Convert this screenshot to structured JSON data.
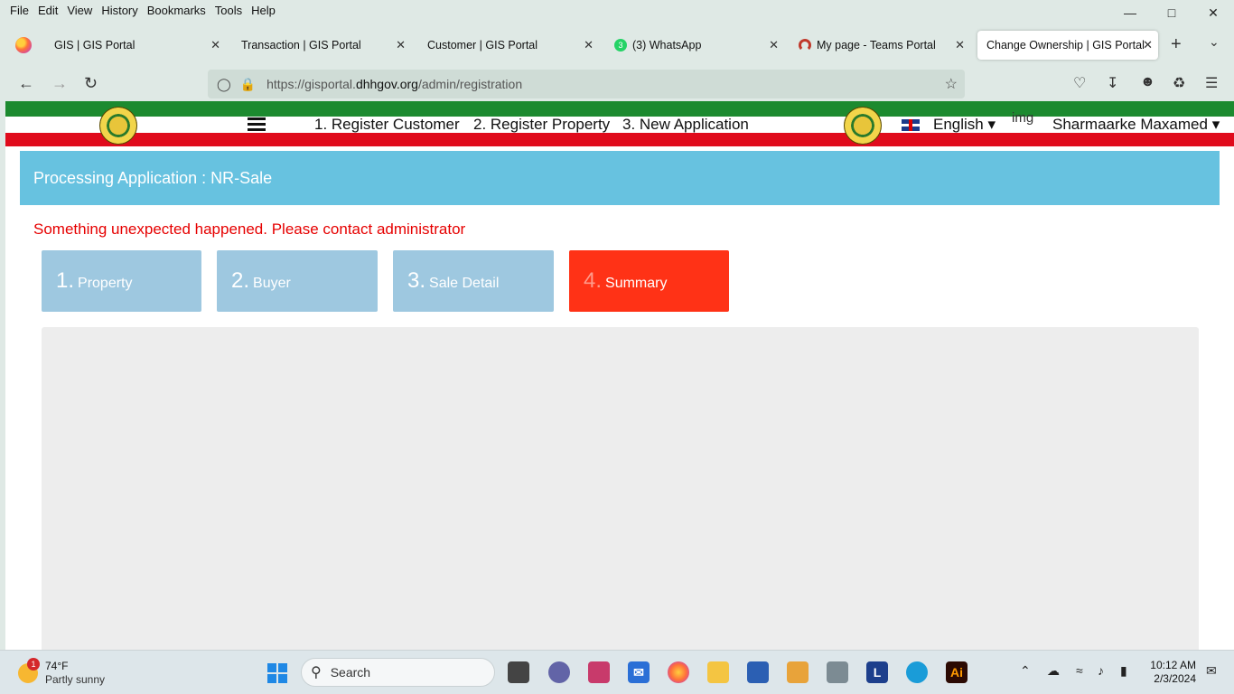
{
  "menubar": {
    "items": [
      "File",
      "Edit",
      "View",
      "History",
      "Bookmarks",
      "Tools",
      "Help"
    ]
  },
  "tabs": [
    {
      "label": "GIS | GIS Portal"
    },
    {
      "label": "Transaction | GIS Portal"
    },
    {
      "label": "Customer | GIS Portal"
    },
    {
      "label": "(3) WhatsApp",
      "badge": "3"
    },
    {
      "label": "My page - Teams Portal"
    },
    {
      "label": "Change Ownership | GIS Portal"
    }
  ],
  "address": {
    "scheme_prefix": "https://gisportal.",
    "host": "dhhgov.org",
    "path": "/admin/registration"
  },
  "site_nav": {
    "links": [
      "1. Register Customer",
      "2. Register Property",
      "3. New Application"
    ],
    "language": "English",
    "img_alt": "img",
    "user": "Sharmaarke Maxamed"
  },
  "panel": {
    "title": "Processing Application : NR-Sale",
    "error": "Something unexpected happened. Please contact administrator"
  },
  "steps": [
    {
      "num": "1.",
      "label": "Property",
      "active": false
    },
    {
      "num": "2.",
      "label": "Buyer",
      "active": false
    },
    {
      "num": "3.",
      "label": "Sale Detail",
      "active": false
    },
    {
      "num": "4.",
      "label": "Summary",
      "active": true
    }
  ],
  "taskbar": {
    "weather_badge": "1",
    "temp": "74°F",
    "condition": "Partly sunny",
    "search_placeholder": "Search",
    "time": "10:12 AM",
    "date": "2/3/2024"
  },
  "colors": {
    "accent_header": "#67c2e0",
    "active_step": "#ff3216",
    "inactive_step": "#9ec8e0",
    "error": "#e60000"
  }
}
